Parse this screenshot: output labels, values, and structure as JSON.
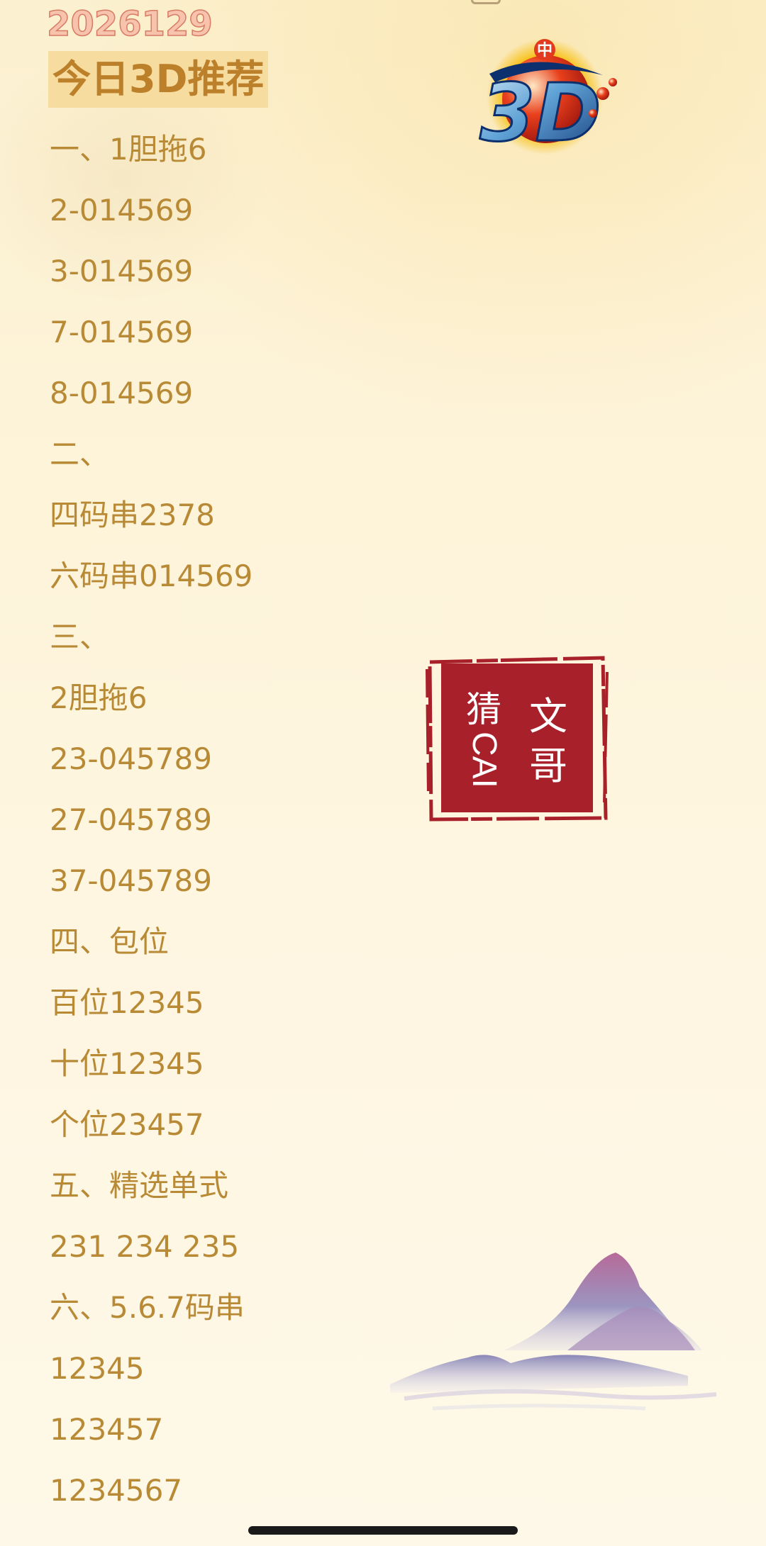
{
  "header": {
    "date": "2026129",
    "title": "今日3D推荐"
  },
  "lines": [
    "一、1胆拖6",
    "2-014569",
    "3-014569",
    "7-014569",
    "8-014569",
    "二、",
    "四码串2378",
    "六码串014569",
    "三、",
    "2胆拖6",
    "23-045789",
    "27-045789",
    "37-045789",
    "四、包位",
    "百位12345",
    "十位12345",
    "个位23457",
    "五、精选单式",
    "231 234 235",
    "六、5.6.7码串",
    "12345",
    "123457",
    "1234567"
  ],
  "logo": {
    "text": "3D",
    "badge": "中"
  },
  "seal": {
    "left_char": "猜",
    "left_latin": "CAI",
    "right_char_1": "文",
    "right_char_2": "哥"
  },
  "colors": {
    "text": "#b98a36",
    "title_bg": "#f7dca0",
    "title_text": "#bc7f2a",
    "date": "#f7c3ad",
    "seal": "#a8202a",
    "background": "#fdf3d8"
  },
  "icons": {
    "logo": "lottery-3d-logo",
    "seal": "seal-stamp",
    "decoration": "mountain-ink-painting"
  }
}
